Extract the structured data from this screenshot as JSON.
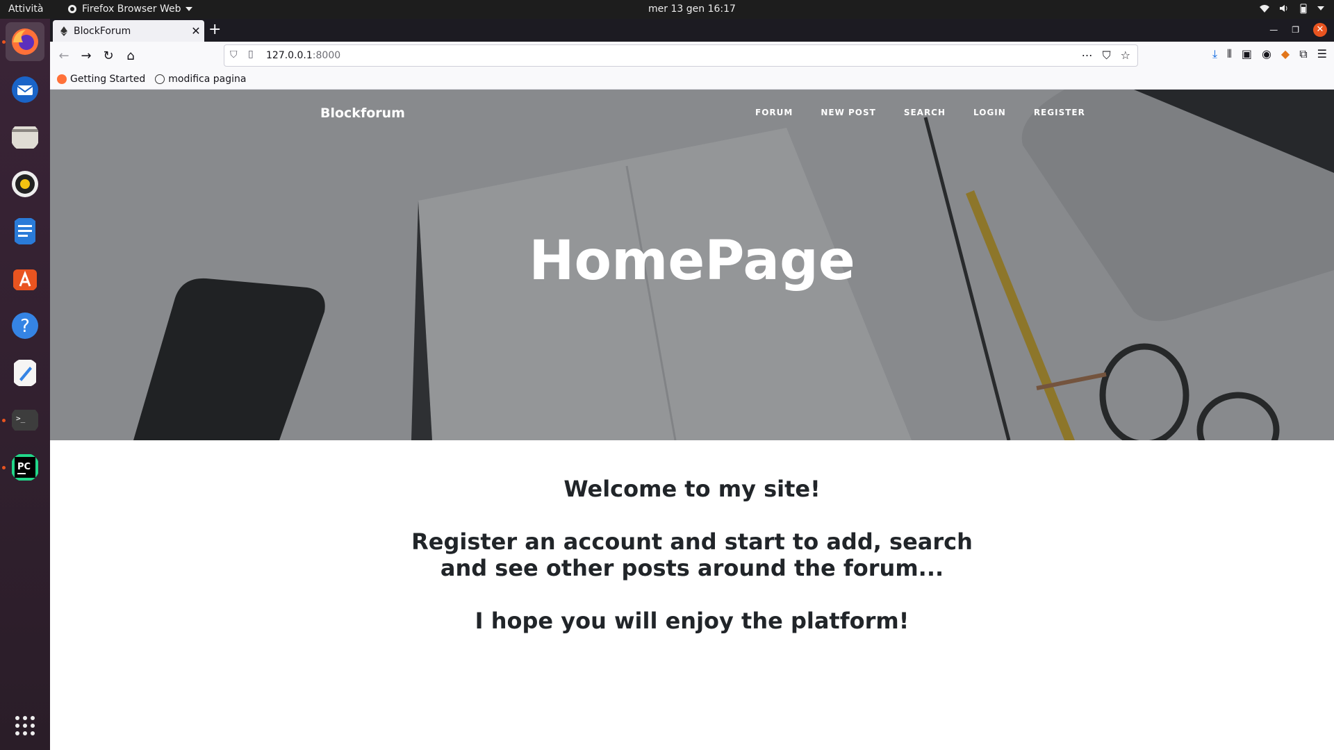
{
  "system": {
    "activities": "Attività",
    "app_menu": "Firefox Browser Web",
    "clock": "mer 13 gen  16:17"
  },
  "dock": {
    "items": [
      "firefox-icon",
      "thunderbird-icon",
      "files-icon",
      "rhythmbox-icon",
      "writer-icon",
      "software-icon",
      "help-icon",
      "text-editor-icon",
      "terminal-icon",
      "pycharm-icon"
    ],
    "show_apps": "show-applications-icon"
  },
  "browser": {
    "tab_title": "BlockForum",
    "url_host": "127.0.0.1",
    "url_port": ":8000",
    "bookmarks": [
      "Getting Started",
      "modifica pagina"
    ]
  },
  "site": {
    "brand": "Blockforum",
    "nav": [
      "FORUM",
      "NEW POST",
      "SEARCH",
      "LOGIN",
      "REGISTER"
    ],
    "hero_title": "HomePage",
    "welcome": "Welcome to my site!",
    "register_line1": "Register an account and start to add, search",
    "register_line2": "and see other posts around the forum...",
    "enjoy": "I hope you will enjoy the platform!"
  },
  "colors": {
    "accent": "#e95420",
    "text": "#212529"
  }
}
